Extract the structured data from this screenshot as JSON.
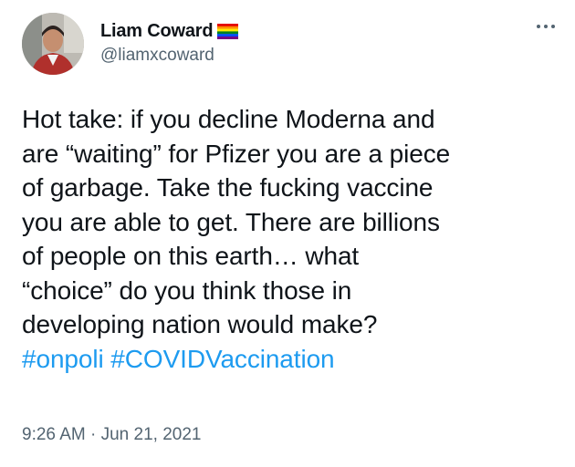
{
  "author": {
    "display_name": "Liam Coward",
    "handle": "@liamxcoward",
    "avatar_icon": "profile-photo",
    "badge_icon": "rainbow-flag-icon"
  },
  "menu": {
    "more_icon": "ellipsis-icon"
  },
  "tweet": {
    "lines": [
      "Hot take: if you decline Moderna and",
      "are “waiting” for Pfizer you are a piece",
      "of garbage. Take the fucking vaccine",
      "you are able to get. There are billions",
      "of people on this earth… what",
      "“choice” do you think those in",
      "developing nation would make?"
    ],
    "hashtags": [
      "#onpoli",
      "#COVIDVaccination"
    ],
    "timestamp": "9:26 AM · Jun 21, 2021"
  },
  "colors": {
    "text": "#0f1419",
    "secondary": "#536471",
    "link": "#1d9bf0"
  }
}
